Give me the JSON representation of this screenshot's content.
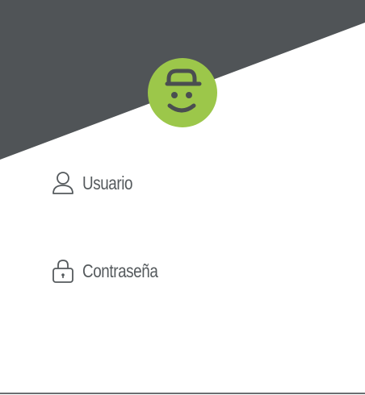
{
  "colors": {
    "header": "#505457",
    "accent": "#9cc74a",
    "text": "#555a5d",
    "rule": "#6a6e71"
  },
  "avatar": {
    "icon": "robot-face-icon"
  },
  "username": {
    "icon": "user-icon",
    "label": "Usuario"
  },
  "password": {
    "icon": "lock-icon",
    "label": "Contraseña"
  }
}
